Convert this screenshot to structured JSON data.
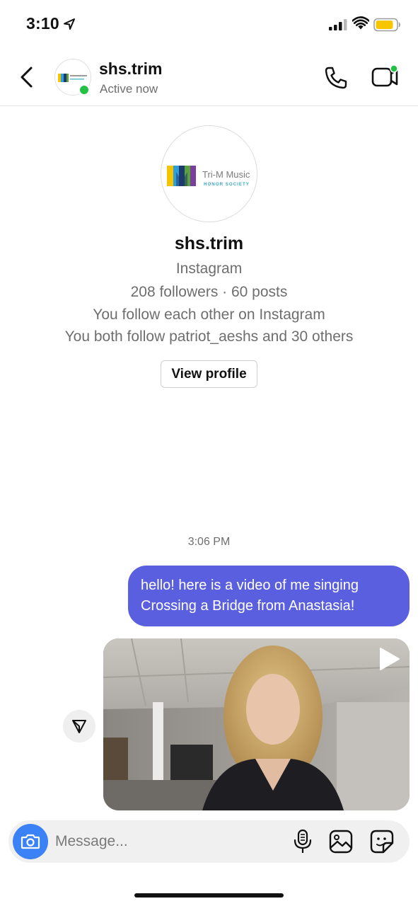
{
  "status_bar": {
    "time": "3:10",
    "icons": [
      "location-arrow-icon",
      "cellular-signal-icon",
      "wifi-icon",
      "battery-icon"
    ],
    "battery_color": "#f7c600"
  },
  "header": {
    "username": "shs.trim",
    "status": "Active now",
    "active_color": "#23c142",
    "icons": [
      "back-chevron-icon",
      "phone-icon",
      "video-call-icon"
    ]
  },
  "logo": {
    "line1": "Tri-M Music",
    "line2": "HONOR SOCIETY"
  },
  "profile": {
    "username": "shs.trim",
    "platform": "Instagram",
    "stats": "208 followers · 60 posts",
    "mutual_follow": "You follow each other on Instagram",
    "mutual_friends": "You both follow patriot_aeshs and 30 others",
    "view_profile_label": "View profile"
  },
  "conversation": {
    "timestamp": "3:06 PM",
    "message_line1": "hello! here is a video of me singing",
    "message_line2": "Crossing a Bridge from Anastasia!",
    "bubble_color": "#5a5fe0",
    "video_icons": [
      "play-icon",
      "share-icon"
    ]
  },
  "composer": {
    "placeholder": "Message...",
    "icons": [
      "camera-icon",
      "microphone-icon",
      "gallery-icon",
      "sticker-icon"
    ],
    "camera_color": "#3b82f6"
  }
}
